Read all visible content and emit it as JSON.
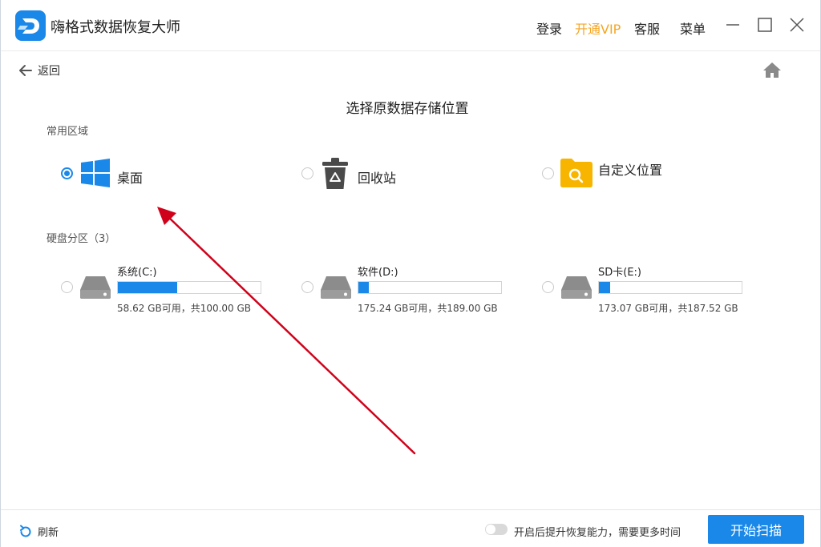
{
  "window": {
    "title": "嗨格式数据恢复大师",
    "menu": {
      "login": "登录",
      "vip": "开通VIP",
      "service": "客服",
      "menu": "菜单"
    }
  },
  "nav": {
    "back_label": "返回"
  },
  "page": {
    "title": "选择原数据存储位置"
  },
  "common_area": {
    "label": "常用区域",
    "items": [
      {
        "label": "桌面",
        "icon": "windows-icon",
        "selected": true
      },
      {
        "label": "回收站",
        "icon": "recycle-bin-icon",
        "selected": false
      },
      {
        "label": "自定义位置",
        "icon": "folder-search-icon",
        "selected": false
      }
    ]
  },
  "disks": {
    "label": "硬盘分区（3）",
    "items": [
      {
        "name": "系统(C:)",
        "info": "58.62 GB可用，共100.00 GB",
        "used_fraction": 0.414
      },
      {
        "name": "软件(D:)",
        "info": "175.24 GB可用，共189.00 GB",
        "used_fraction": 0.073
      },
      {
        "name": "SD卡(E:)",
        "info": "173.07 GB可用，共187.52 GB",
        "used_fraction": 0.077
      }
    ]
  },
  "footer": {
    "refresh_label": "刷新",
    "toggle_label": "开启后提升恢复能力，需要更多时间",
    "toggle_on": false,
    "start_label": "开始扫描"
  },
  "colors": {
    "accent": "#1a88e8",
    "vip": "#f5a623",
    "annotation_arrow": "#d0021b"
  }
}
